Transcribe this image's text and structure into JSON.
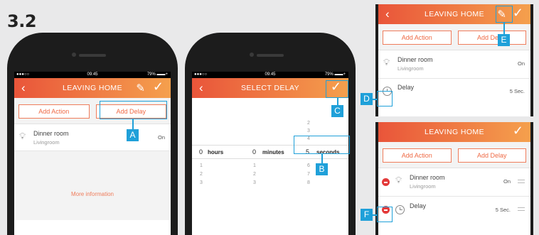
{
  "step_label": "3.2",
  "phone1": {
    "status": {
      "signal": "●●●○○",
      "time": "09:45",
      "battery": "79% ▬▬+"
    },
    "header": {
      "back": "‹",
      "title": "LEAVING HOME",
      "ok": "✓"
    },
    "toolbar": {
      "add_action": "Add Action",
      "add_delay": "Add Delay"
    },
    "items": [
      {
        "name": "Dinner room",
        "room": "Livingroom",
        "state": "On"
      }
    ],
    "more_info": "More information"
  },
  "phone2": {
    "status": {
      "signal": "●●●○○",
      "time": "09:45",
      "battery": "79% ▬▬+"
    },
    "header": {
      "back": "‹",
      "title": "SELECT DELAY",
      "ok": "✓"
    },
    "picker": {
      "hours_value": "0",
      "hours_label": "hours",
      "minutes_value": "0",
      "minutes_label": "minutes",
      "seconds_value": "5",
      "seconds_label": "seconds",
      "hours_below": [
        "1",
        "2",
        "3"
      ],
      "minutes_below": [
        "1",
        "2",
        "3"
      ],
      "seconds_above": [
        "2",
        "3",
        "4"
      ],
      "seconds_below": [
        "6",
        "7",
        "8"
      ]
    }
  },
  "panel3": {
    "header": {
      "back": "‹",
      "title": "LEAVING HOME",
      "ok": "✓"
    },
    "toolbar": {
      "add_action": "Add Action",
      "add_delay": "Add Delay"
    },
    "items": [
      {
        "name": "Dinner room",
        "room": "Livingroom",
        "state": "On"
      },
      {
        "name": "Delay",
        "state": "5 Sec."
      }
    ]
  },
  "panel4": {
    "header": {
      "title": "LEAVING HOME",
      "ok": "✓"
    },
    "toolbar": {
      "add_action": "Add Action",
      "add_delay": "Add Delay"
    },
    "items": [
      {
        "name": "Dinner room",
        "room": "Livingroom",
        "state": "On"
      },
      {
        "name": "Delay",
        "state": "5 Sec."
      }
    ]
  },
  "callouts": {
    "a": "A",
    "b": "B",
    "c": "C",
    "d": "D",
    "e": "E",
    "f": "F"
  },
  "colors": {
    "accent": "#ef6a45",
    "callout": "#1fa0d9",
    "delete": "#e33a3a"
  },
  "icons": {
    "bulb": "lightbulb-icon",
    "clock": "clock-icon",
    "pencil": "pencil-icon",
    "check": "check-icon"
  }
}
